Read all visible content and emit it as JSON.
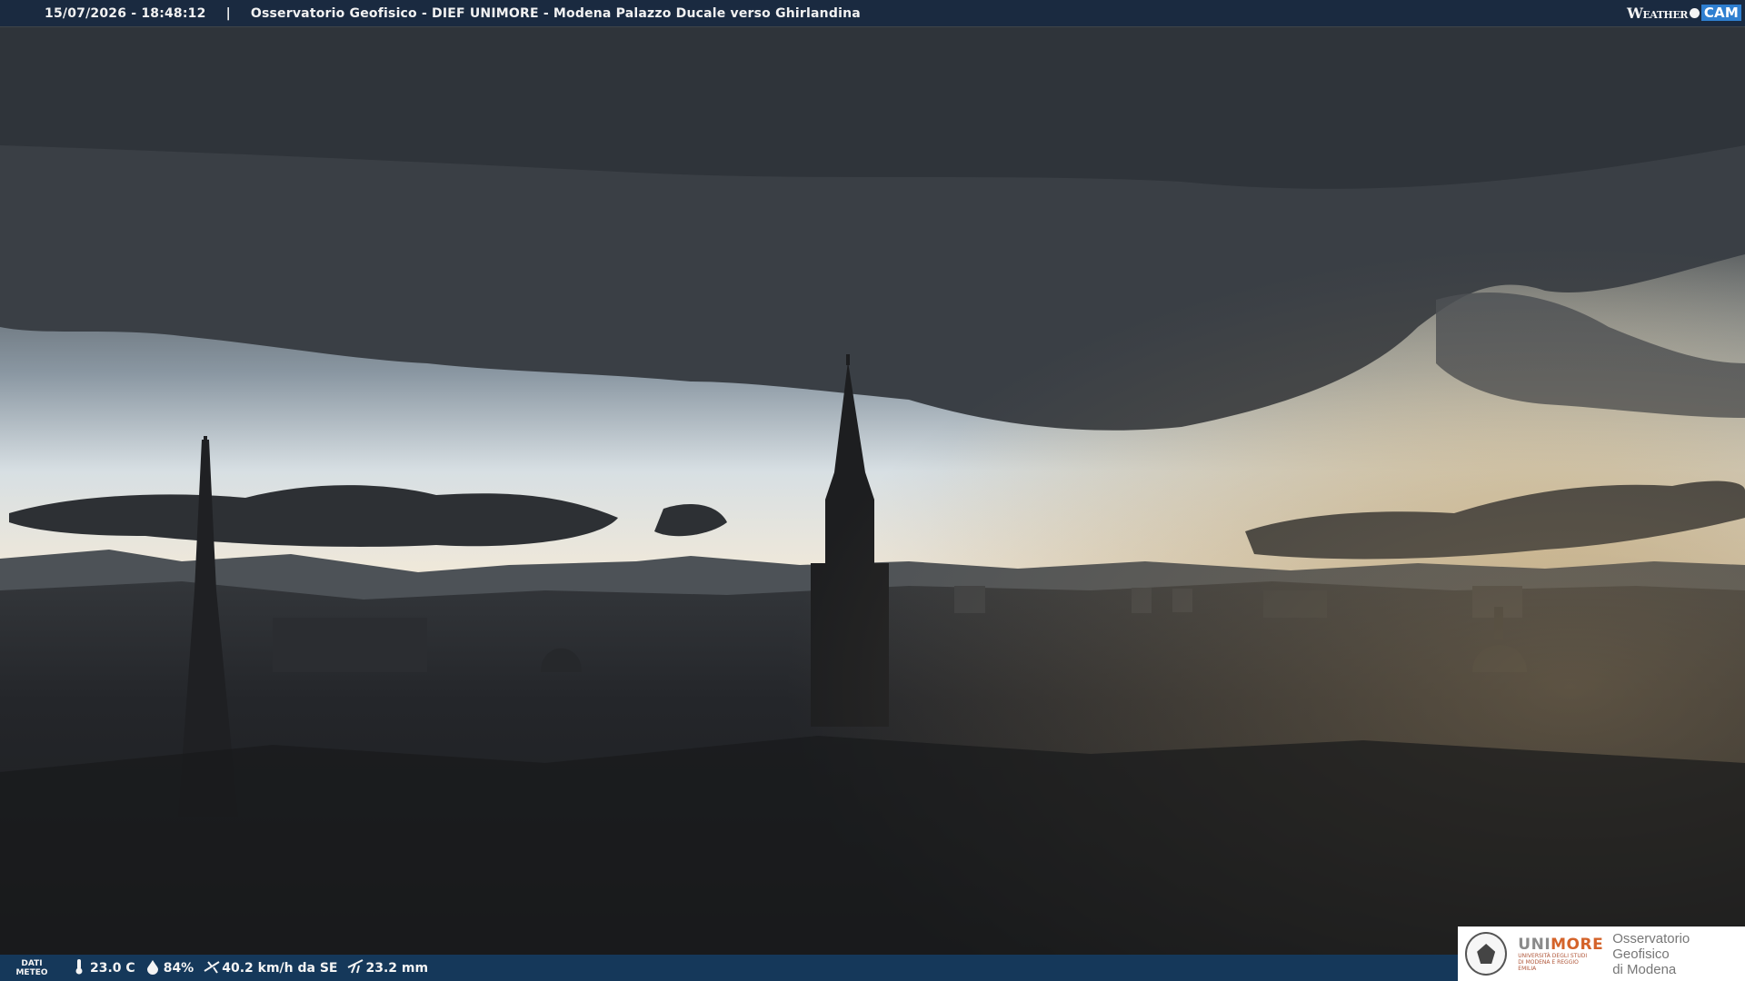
{
  "header": {
    "datetime": "15/07/2026 - 18:48:12",
    "separator": "|",
    "title": "Osservatorio Geofisico - DIEF UNIMORE - Modena Palazzo Ducale verso Ghirlandina",
    "brand_weather": "Weather",
    "brand_cam": "CAM"
  },
  "weather_bar": {
    "label_line1": "DATI",
    "label_line2": "METEO",
    "temperature": "23.0 C",
    "humidity": "84%",
    "wind": "40.2 km/h da SE",
    "rain": "23.2 mm",
    "icons": [
      "thermometer-icon",
      "humidity-drop-icon",
      "wind-icon",
      "rain-gauge-icon"
    ]
  },
  "logo": {
    "uni_part1": "UNI",
    "uni_part2": "MORE",
    "uni_subtitle": "UNIVERSITÀ DEGLI STUDI DI MODENA E REGGIO EMILIA",
    "obs_line1": "Osservatorio Geofisico",
    "obs_line2": "di Modena"
  },
  "colors": {
    "header_bg": "#1a2a40",
    "bottom_bar_bg": "#15385a",
    "unimore_orange": "#d4632a",
    "weathercam_blue": "#2f7fd0"
  }
}
